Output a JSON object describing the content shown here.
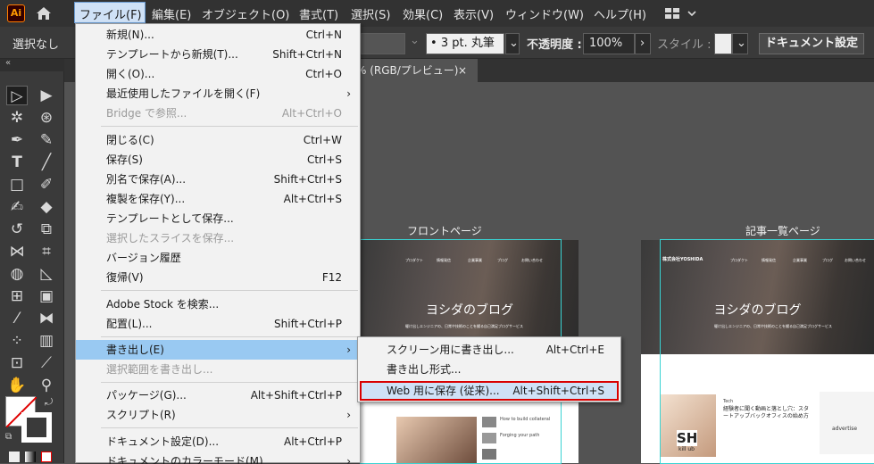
{
  "app": {
    "logo": "Ai",
    "menubar": {
      "items": [
        "ファイル(F)",
        "編集(E)",
        "オブジェクト(O)",
        "書式(T)",
        "選択(S)",
        "効果(C)",
        "表示(V)",
        "ウィンドウ(W)",
        "ヘルプ(H)"
      ]
    },
    "control": {
      "selection": "選択なし",
      "stroke": "3 pt. 丸筆",
      "opacity_label": "不透明度 :",
      "opacity_value": "100%",
      "style_label": "スタイル :",
      "doc_settings": "ドキュメント設定"
    },
    "tab": {
      "title": "% (RGB/プレビュー)",
      "close": "×"
    }
  },
  "file_menu": {
    "items": [
      {
        "label": "新規(N)...",
        "shortcut": "Ctrl+N"
      },
      {
        "label": "テンプレートから新規(T)...",
        "shortcut": "Shift+Ctrl+N"
      },
      {
        "label": "開く(O)...",
        "shortcut": "Ctrl+O"
      },
      {
        "label": "最近使用したファイルを開く(F)",
        "shortcut": ""
      },
      {
        "label": "Bridge で参照...",
        "shortcut": "Alt+Ctrl+O"
      },
      {
        "label": "閉じる(C)",
        "shortcut": "Ctrl+W"
      },
      {
        "label": "保存(S)",
        "shortcut": "Ctrl+S"
      },
      {
        "label": "別名で保存(A)...",
        "shortcut": "Shift+Ctrl+S"
      },
      {
        "label": "複製を保存(Y)...",
        "shortcut": "Alt+Ctrl+S"
      },
      {
        "label": "テンプレートとして保存...",
        "shortcut": ""
      },
      {
        "label": "選択したスライスを保存...",
        "shortcut": ""
      },
      {
        "label": "バージョン履歴",
        "shortcut": ""
      },
      {
        "label": "復帰(V)",
        "shortcut": "F12"
      },
      {
        "label": "Adobe Stock を検索...",
        "shortcut": ""
      },
      {
        "label": "配置(L)...",
        "shortcut": "Shift+Ctrl+P"
      },
      {
        "label": "書き出し(E)",
        "shortcut": ""
      },
      {
        "label": "選択範囲を書き出し...",
        "shortcut": ""
      },
      {
        "label": "パッケージ(G)...",
        "shortcut": "Alt+Shift+Ctrl+P"
      },
      {
        "label": "スクリプト(R)",
        "shortcut": ""
      },
      {
        "label": "ドキュメント設定(D)...",
        "shortcut": "Alt+Ctrl+P"
      },
      {
        "label": "ドキュメントのカラーモード(M)",
        "shortcut": ""
      }
    ],
    "arrow": "›"
  },
  "export_submenu": {
    "items": [
      {
        "label": "スクリーン用に書き出し...",
        "shortcut": "Alt+Ctrl+E"
      },
      {
        "label": "書き出し形式...",
        "shortcut": ""
      },
      {
        "label": "Web 用に保存 (従来)...",
        "shortcut": "Alt+Shift+Ctrl+S"
      }
    ]
  },
  "canvas": {
    "artboard1_label": "フロントページ",
    "artboard2_label": "記事一覧ページ",
    "hero_title": "ヨシダのブログ",
    "site_name": "株式会社YOSHIDA",
    "nav": [
      "プロダクト",
      "情報発信",
      "企業事業",
      "ブログ",
      "お問い合わせ"
    ],
    "hero_sub": "駆け出しエンジニアの、日常や技術のことを綴る自己満足ブログサービス",
    "article_title": "経験者に聞く動画と落とし穴：スタートアップバックオフィスの始め方",
    "article_tag": "Tech",
    "ad_text": "advertise",
    "thumb_badge": "SH",
    "thumb_caption": "kill ub",
    "post_title": "How to build collateral",
    "post_title2": "Forging your path"
  },
  "colors": {
    "menu_bg": "#f2f2f2",
    "highlight": "#99c9f2",
    "red_box": "#d90000",
    "artboard_outline": "#39d3d3"
  }
}
